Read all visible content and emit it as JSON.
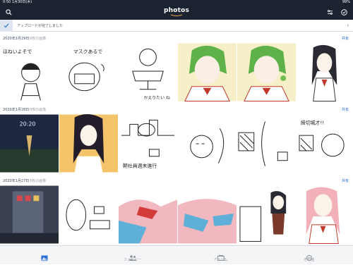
{
  "status_bar": {
    "time_date": "0:50  1月30日(木)",
    "battery": "99%"
  },
  "header": {
    "brand": "photos"
  },
  "upload_bar": {
    "message": "アップロードが完了しました"
  },
  "sections": [
    {
      "date": "2020年1月29日",
      "sub": "8枚の画像",
      "share": "共有"
    },
    {
      "date": "2020年1月28日",
      "sub": "8枚の画像",
      "share": "共有"
    },
    {
      "date": "2020年1月27日",
      "sub": "8枚の画像",
      "share": "共有"
    }
  ],
  "drawing_text": {
    "r1_t1": "ほねいよそで",
    "r1_t2": "マスクあるで",
    "r1_t3": "かえりたい ね",
    "r2_t1": "20:20",
    "r2_t3": "朝社員週末進行",
    "r2_t6": "締切城才!!"
  },
  "tabs": [
    {
      "label": "写真",
      "icon": "photo-icon"
    },
    {
      "label": "ファミリー",
      "icon": "family-icon"
    },
    {
      "label": "アルバム",
      "icon": "album-icon"
    },
    {
      "label": "その他",
      "icon": "more-icon"
    }
  ],
  "colors": {
    "header": "#1b2230",
    "accent": "#2c6fd6"
  }
}
